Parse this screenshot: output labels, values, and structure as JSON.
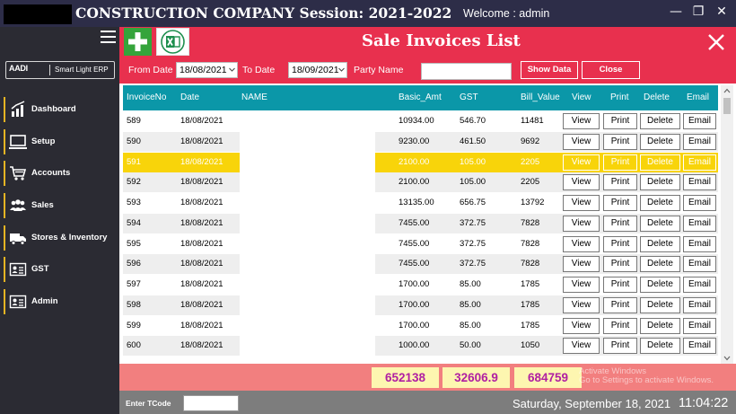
{
  "window": {
    "title": "CONSTRUCTION COMPANY Session: 2021-2022",
    "welcome": "Welcome : admin",
    "controls": {
      "minimize": "—",
      "maximize": "❐",
      "close": "✕"
    }
  },
  "sidebar": {
    "logo": {
      "mark": "AADI",
      "text": "Smart Light ERP"
    },
    "accent_color": "#e4b423",
    "items": [
      {
        "label": "Dashboard",
        "icon": "bar-chart-icon"
      },
      {
        "label": "Setup",
        "icon": "monitor-icon"
      },
      {
        "label": "Accounts",
        "icon": "cart-icon"
      },
      {
        "label": "Sales",
        "icon": "users-icon"
      },
      {
        "label": "Stores & Inventory",
        "icon": "truck-icon"
      },
      {
        "label": "GST",
        "icon": "id-card-icon"
      },
      {
        "label": "Admin",
        "icon": "id-card-icon"
      }
    ]
  },
  "header": {
    "title": "Sale Invoices List",
    "color": "#e8304e"
  },
  "filters": {
    "from_label": "From Date",
    "from_value": "18/08/2021",
    "to_label": "To Date",
    "to_value": "18/09/2021",
    "party_label": "Party Name",
    "party_value": "",
    "show_label": "Show Data",
    "close_label": "Close"
  },
  "table": {
    "header_color": "#0b97a8",
    "columns": [
      "InvoiceNo",
      "Date",
      "NAME",
      "Basic_Amt",
      "GST",
      "Bill_Value",
      "View",
      "Print",
      "Delete",
      "Email"
    ],
    "action_labels": {
      "view": "View",
      "print": "Print",
      "delete": "Delete",
      "email": "Email"
    },
    "selected_index": 2,
    "selected_color": "#f8d40a",
    "rows": [
      {
        "invoice": "589",
        "date": "18/08/2021",
        "name": "",
        "basic": "10934.00",
        "gst": "546.70",
        "bill": "11481"
      },
      {
        "invoice": "590",
        "date": "18/08/2021",
        "name": "",
        "basic": "9230.00",
        "gst": "461.50",
        "bill": "9692"
      },
      {
        "invoice": "591",
        "date": "18/08/2021",
        "name": "",
        "basic": "2100.00",
        "gst": "105.00",
        "bill": "2205"
      },
      {
        "invoice": "592",
        "date": "18/08/2021",
        "name": "",
        "basic": "2100.00",
        "gst": "105.00",
        "bill": "2205"
      },
      {
        "invoice": "593",
        "date": "18/08/2021",
        "name": "",
        "basic": "13135.00",
        "gst": "656.75",
        "bill": "13792"
      },
      {
        "invoice": "594",
        "date": "18/08/2021",
        "name": "",
        "basic": "7455.00",
        "gst": "372.75",
        "bill": "7828"
      },
      {
        "invoice": "595",
        "date": "18/08/2021",
        "name": "",
        "basic": "7455.00",
        "gst": "372.75",
        "bill": "7828"
      },
      {
        "invoice": "596",
        "date": "18/08/2021",
        "name": "",
        "basic": "7455.00",
        "gst": "372.75",
        "bill": "7828"
      },
      {
        "invoice": "597",
        "date": "18/08/2021",
        "name": "",
        "basic": "1700.00",
        "gst": "85.00",
        "bill": "1785"
      },
      {
        "invoice": "598",
        "date": "18/08/2021",
        "name": "",
        "basic": "1700.00",
        "gst": "85.00",
        "bill": "1785"
      },
      {
        "invoice": "599",
        "date": "18/08/2021",
        "name": "",
        "basic": "1700.00",
        "gst": "85.00",
        "bill": "1785"
      },
      {
        "invoice": "600",
        "date": "18/08/2021",
        "name": "",
        "basic": "1000.00",
        "gst": "50.00",
        "bill": "1050"
      }
    ]
  },
  "totals": {
    "basic": "652138",
    "gst": "32606.9",
    "bill": "684759",
    "watermark_line1": "Activate Windows",
    "watermark_line2": "Go to Settings to activate Windows."
  },
  "status": {
    "tcode_label": "Enter TCode",
    "tcode_value": "",
    "date": "Saturday, September 18, 2021",
    "time": "11:04:22"
  }
}
